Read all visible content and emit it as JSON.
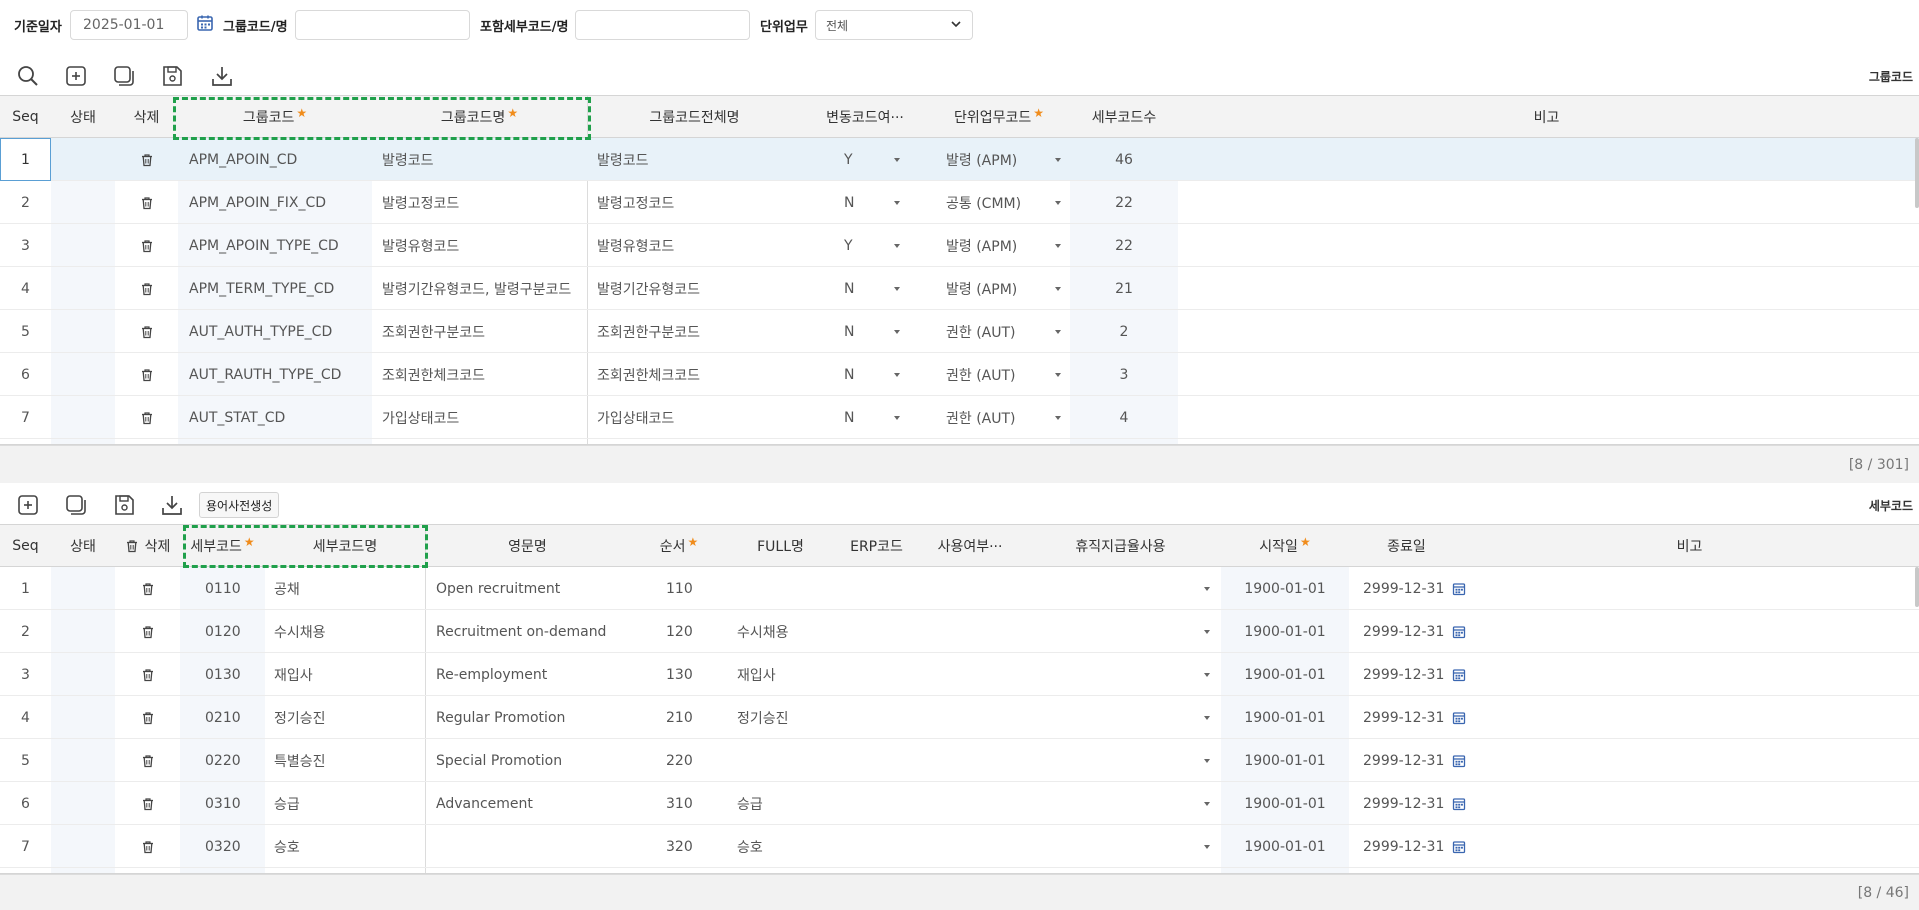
{
  "search": {
    "base_date_label": "기준일자",
    "base_date_value": "2025-01-01",
    "group_code_label": "그룹코드/명",
    "group_code_value": "",
    "detail_code_label": "포함세부코드/명",
    "detail_code_value": "",
    "unit_work_label": "단위업무",
    "unit_work_value": "전체"
  },
  "group_grid": {
    "title": "그룹코드",
    "headers": {
      "seq": "Seq",
      "status": "상태",
      "delete": "삭제",
      "group_code": "그룹코드",
      "group_code_name": "그룹코드명",
      "group_code_full_name": "그룹코드전체명",
      "variable_code": "변동코드여···",
      "unit_work_code": "단위업무코드",
      "detail_count": "세부코드수",
      "remark": "비고"
    },
    "rows": [
      {
        "seq": "1",
        "code": "APM_APOIN_CD",
        "name": "발령코드",
        "full_name": "발령코드",
        "variable": "Y",
        "unit": "발령 (APM)",
        "count": "46"
      },
      {
        "seq": "2",
        "code": "APM_APOIN_FIX_CD",
        "name": "발령고정코드",
        "full_name": "발령고정코드",
        "variable": "N",
        "unit": "공통 (CMM)",
        "count": "22"
      },
      {
        "seq": "3",
        "code": "APM_APOIN_TYPE_CD",
        "name": "발령유형코드",
        "full_name": "발령유형코드",
        "variable": "Y",
        "unit": "발령 (APM)",
        "count": "22"
      },
      {
        "seq": "4",
        "code": "APM_TERM_TYPE_CD",
        "name": "발령기간유형코드, 발령구분코드",
        "full_name": "발령기간유형코드",
        "variable": "N",
        "unit": "발령 (APM)",
        "count": "21"
      },
      {
        "seq": "5",
        "code": "AUT_AUTH_TYPE_CD",
        "name": "조회권한구분코드",
        "full_name": "조회권한구분코드",
        "variable": "N",
        "unit": "권한 (AUT)",
        "count": "2"
      },
      {
        "seq": "6",
        "code": "AUT_RAUTH_TYPE_CD",
        "name": "조회권한체크코드",
        "full_name": "조회권한체크코드",
        "variable": "N",
        "unit": "권한 (AUT)",
        "count": "3"
      },
      {
        "seq": "7",
        "code": "AUT_STAT_CD",
        "name": "가입상태코드",
        "full_name": "가입상태코드",
        "variable": "N",
        "unit": "권한 (AUT)",
        "count": "4"
      }
    ],
    "paging": "[8 / 301]"
  },
  "detail_grid": {
    "title": "세부코드",
    "term_button_label": "용어사전생성",
    "headers": {
      "seq": "Seq",
      "status": "상태",
      "delete": "삭제",
      "detail_code": "세부코드",
      "detail_code_name": "세부코드명",
      "english_name": "영문명",
      "order": "순서",
      "full_name": "FULL명",
      "erp_code": "ERP코드",
      "use_yn": "사용여부···",
      "leave_pay_use": "휴직지급율사용",
      "start_date": "시작일",
      "end_date": "종료일",
      "remark": "비고"
    },
    "rows": [
      {
        "seq": "1",
        "code": "0110",
        "name": "공채",
        "english": "Open recruitment",
        "order": "110",
        "full_name": "",
        "start": "1900-01-01",
        "end": "2999-12-31"
      },
      {
        "seq": "2",
        "code": "0120",
        "name": "수시채용",
        "english": "Recruitment on-demand",
        "order": "120",
        "full_name": "수시채용",
        "start": "1900-01-01",
        "end": "2999-12-31"
      },
      {
        "seq": "3",
        "code": "0130",
        "name": "재입사",
        "english": "Re-employment",
        "order": "130",
        "full_name": "재입사",
        "start": "1900-01-01",
        "end": "2999-12-31"
      },
      {
        "seq": "4",
        "code": "0210",
        "name": "정기승진",
        "english": "Regular Promotion",
        "order": "210",
        "full_name": "정기승진",
        "start": "1900-01-01",
        "end": "2999-12-31"
      },
      {
        "seq": "5",
        "code": "0220",
        "name": "특별승진",
        "english": "Special Promotion",
        "order": "220",
        "full_name": "",
        "start": "1900-01-01",
        "end": "2999-12-31"
      },
      {
        "seq": "6",
        "code": "0310",
        "name": "승급",
        "english": "Advancement",
        "order": "310",
        "full_name": "승급",
        "start": "1900-01-01",
        "end": "2999-12-31"
      },
      {
        "seq": "7",
        "code": "0320",
        "name": "승호",
        "english": "",
        "order": "320",
        "full_name": "승호",
        "start": "1900-01-01",
        "end": "2999-12-31"
      }
    ],
    "paging": "[8 / 46]"
  },
  "colors": {
    "highlight_dashed": "#20a04b",
    "required_star": "#f08c1c",
    "selected_row": "#e8f2f9",
    "calendar_icon": "#3a66b0"
  }
}
